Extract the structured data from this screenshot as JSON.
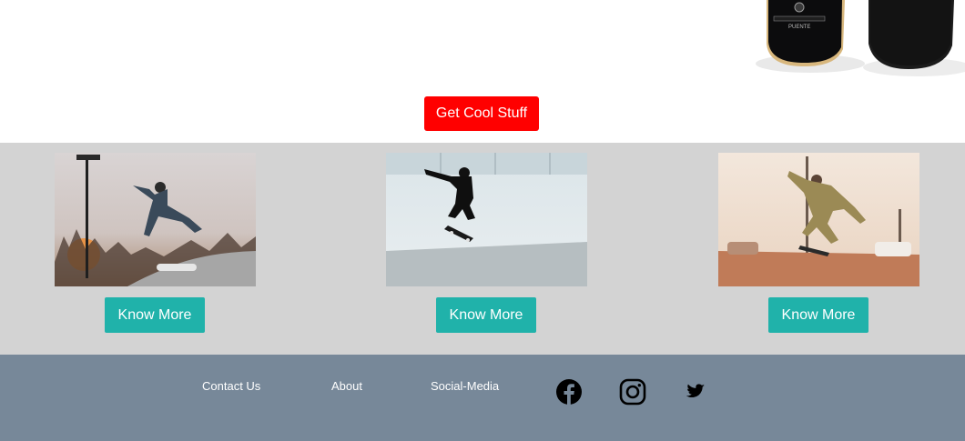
{
  "hero": {
    "button_label": "Get Cool Stuff",
    "board_brand": "PUENTE"
  },
  "gallery": {
    "cards": [
      {
        "button_label": "Know More"
      },
      {
        "button_label": "Know More"
      },
      {
        "button_label": "Know More"
      }
    ]
  },
  "footer": {
    "links": [
      {
        "label": "Contact Us"
      },
      {
        "label": "About"
      },
      {
        "label": "Social-Media"
      }
    ],
    "social_icons": [
      "facebook-icon",
      "instagram-icon",
      "twitter-icon"
    ]
  },
  "colors": {
    "cta_red": "#ff0000",
    "know_more_teal": "#20b2aa",
    "gallery_bg": "#d3d3d3",
    "footer_bg": "#778899"
  }
}
